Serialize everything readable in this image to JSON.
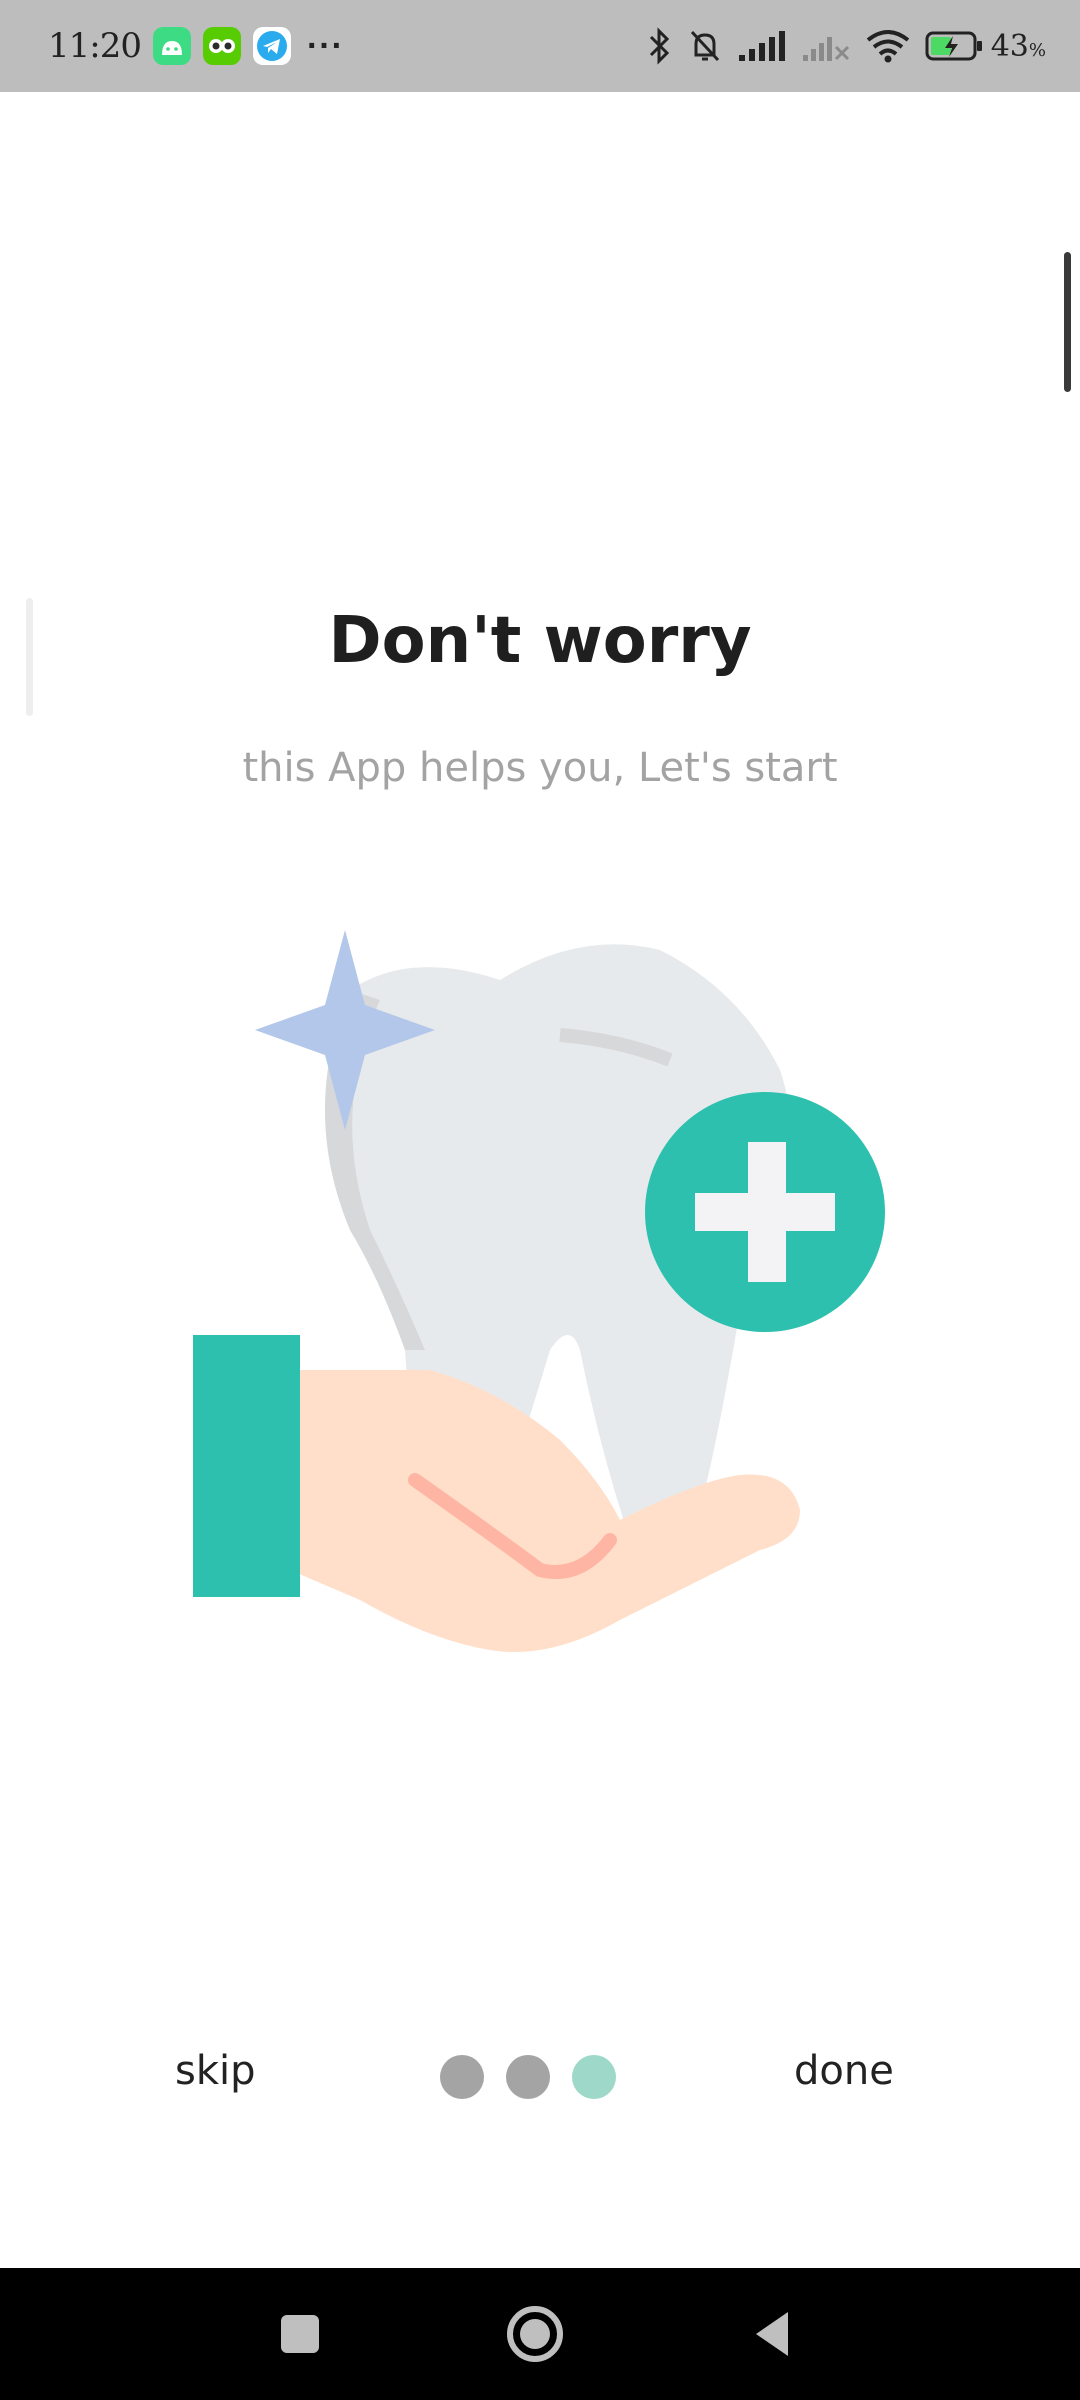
{
  "status_bar": {
    "time": "11:20",
    "battery_percent": "43",
    "battery_unit": "%",
    "more_indicator": "···",
    "icons": [
      "android-icon",
      "owl-app-icon",
      "telegram-icon",
      "bluetooth-icon",
      "bell-muted-icon",
      "signal-icon",
      "signal-no-service-icon",
      "wifi-icon",
      "battery-charging-icon"
    ]
  },
  "onboarding": {
    "title": "Don't worry",
    "subtitle": "this App helps you, Let's start",
    "illustration": "hand-holding-tooth-with-plus-icon"
  },
  "footer": {
    "skip_label": "skip",
    "done_label": "done",
    "page_count": 3,
    "active_page": 3,
    "dot_color": "#a4a4a4",
    "active_dot_color": "#9ed8c8"
  },
  "navigation": {
    "buttons": [
      "recents-button",
      "home-button",
      "back-button"
    ]
  },
  "colors": {
    "accent": "#2ec0ae",
    "status_bar_bg": "#bdbdbd",
    "nav_bar_bg": "#000000"
  }
}
